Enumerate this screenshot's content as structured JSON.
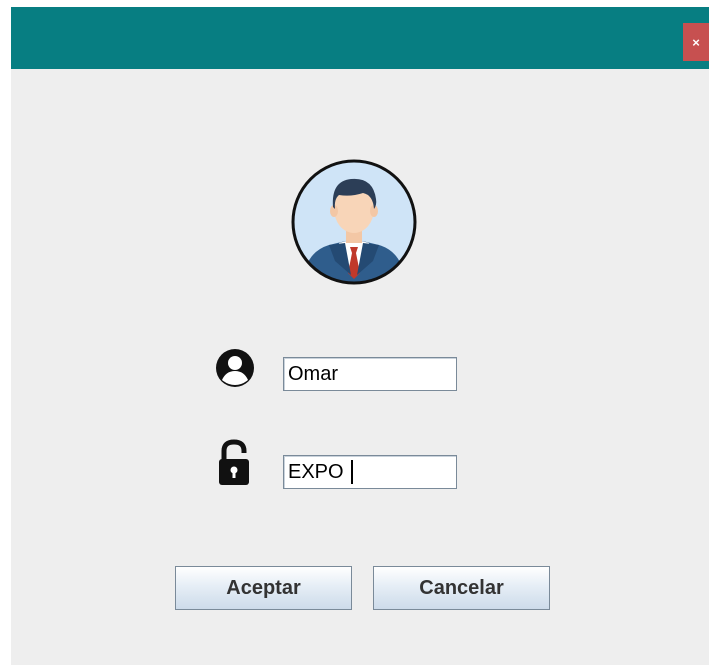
{
  "window": {
    "title_bar_color": "#077e82",
    "close_label": "×",
    "close_color": "#c75050"
  },
  "avatar": {
    "icon": "businessman-avatar-icon"
  },
  "username": {
    "icon": "user-circle-icon",
    "value": "Omar"
  },
  "password": {
    "icon": "padlock-icon",
    "value": "EXPO"
  },
  "buttons": {
    "accept_label": "Aceptar",
    "cancel_label": "Cancelar"
  }
}
